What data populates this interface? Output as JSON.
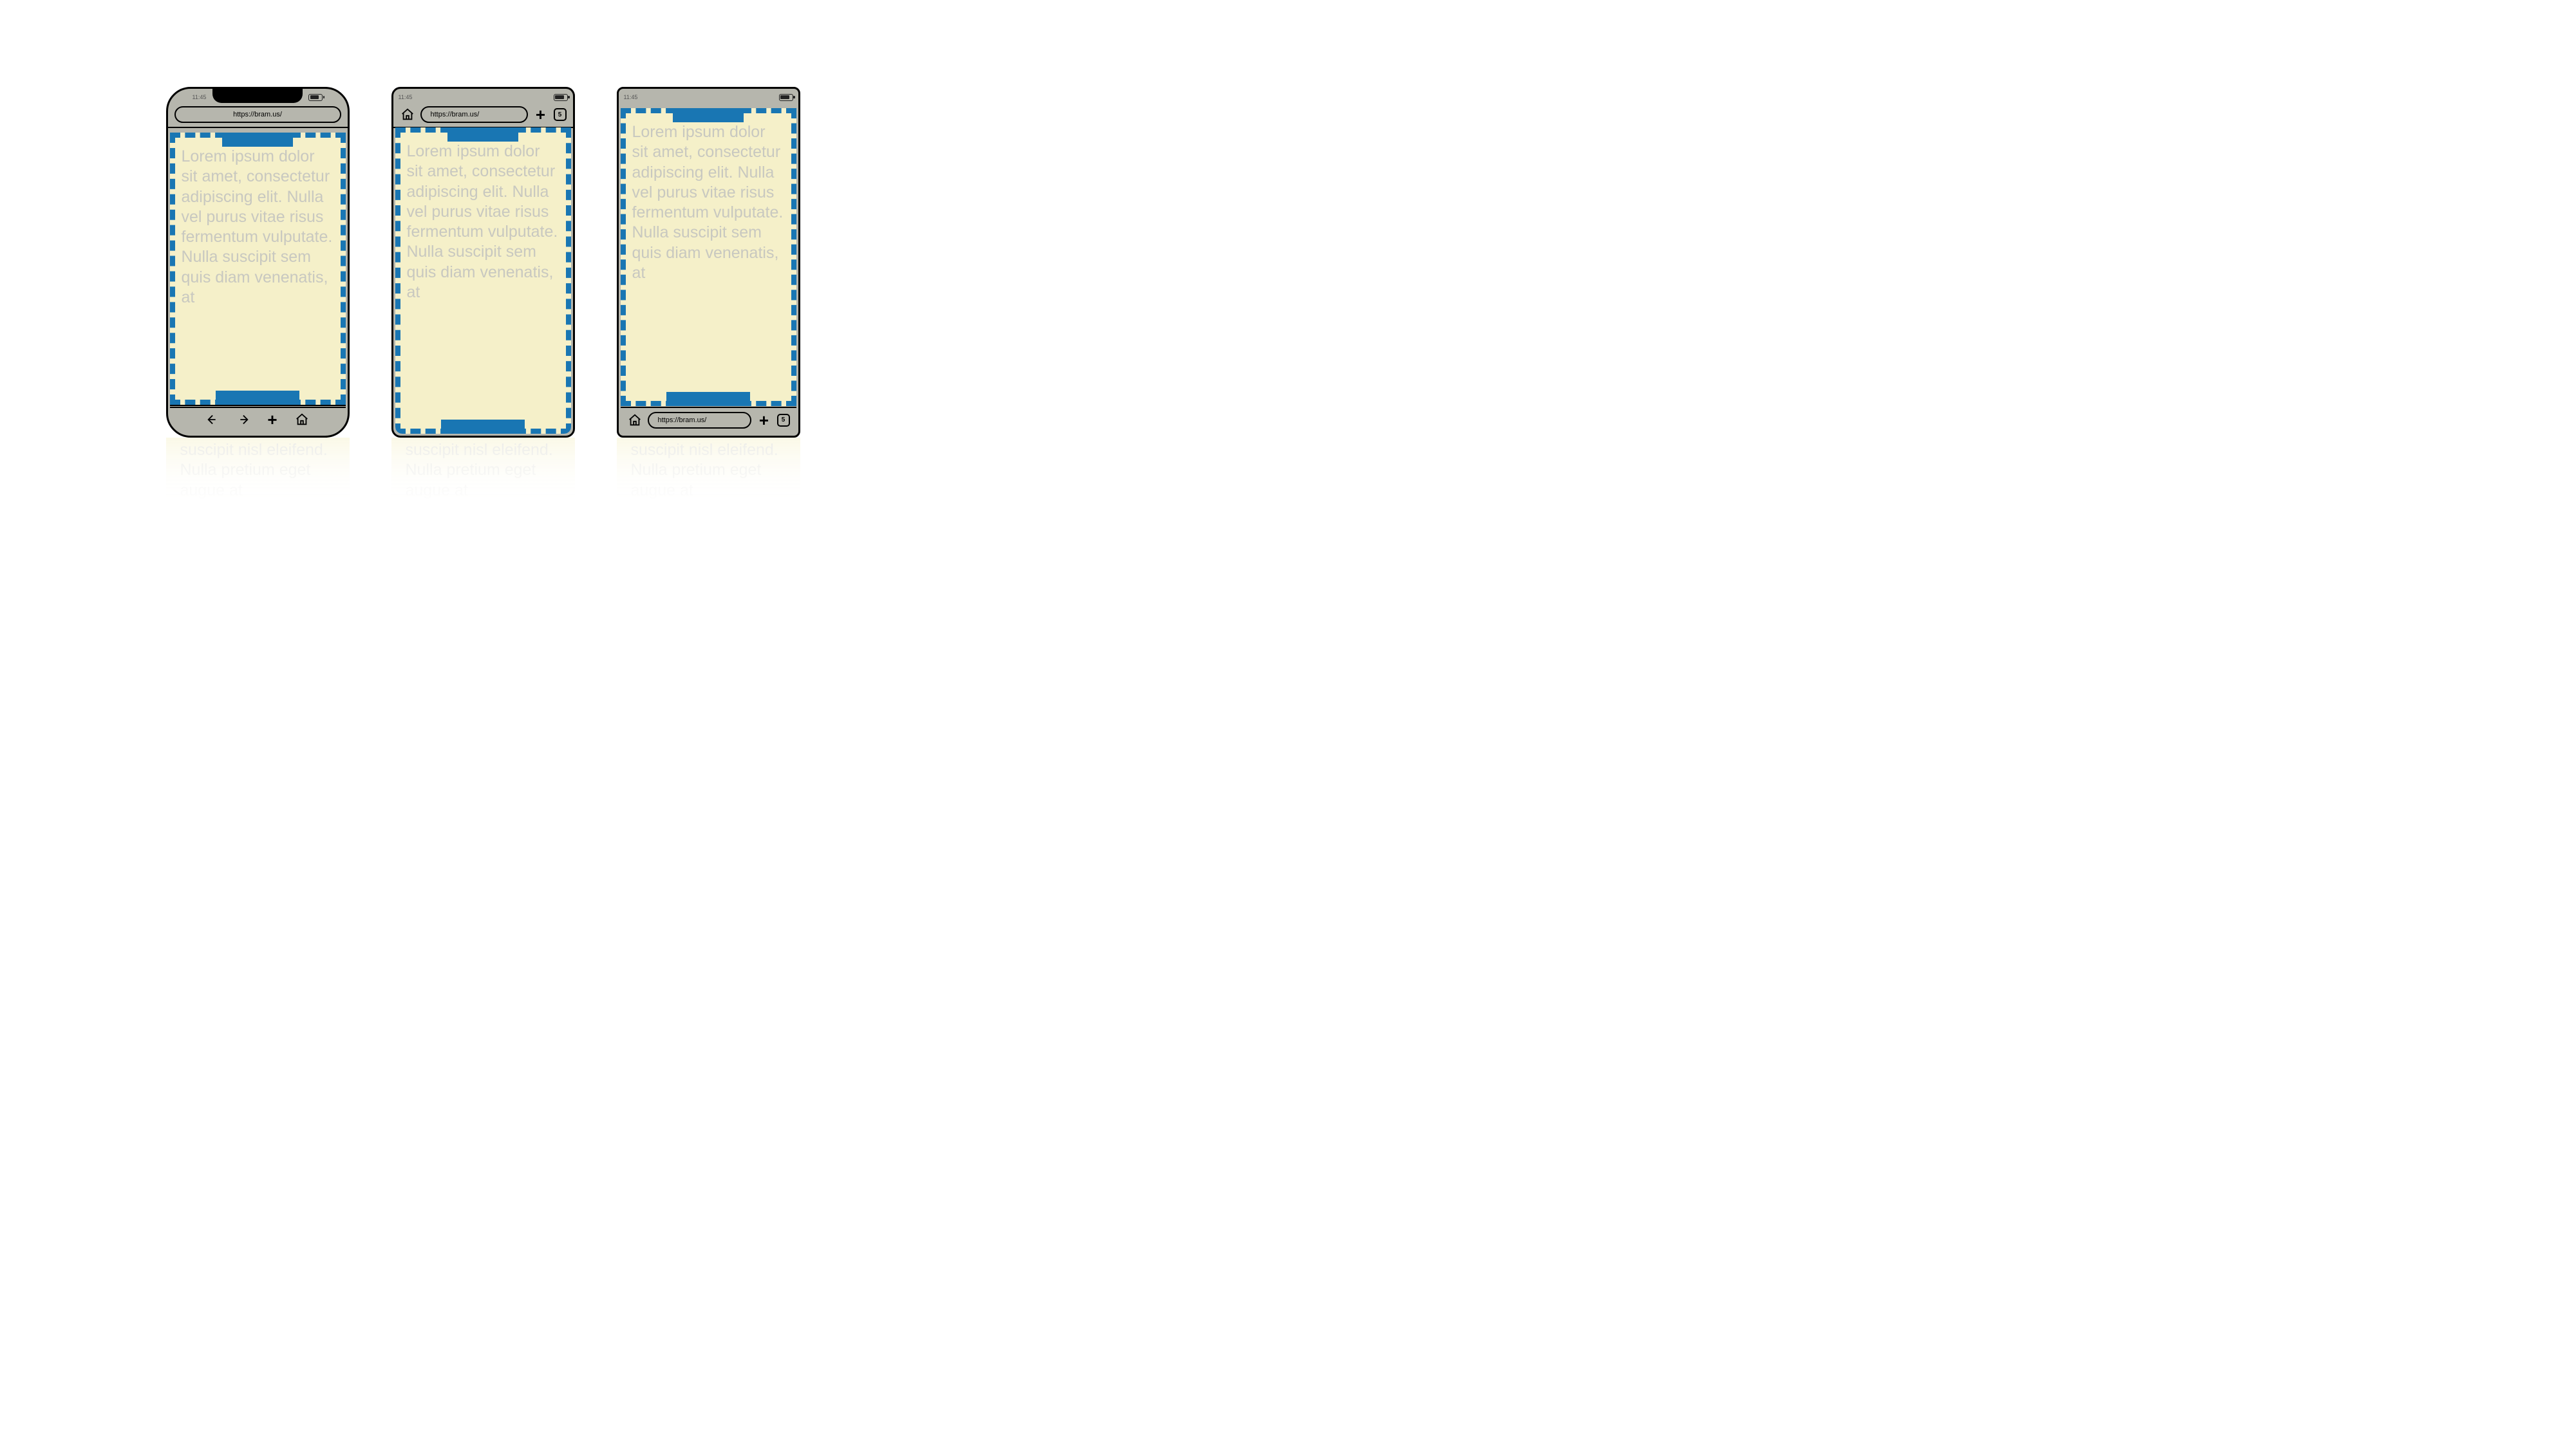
{
  "status": {
    "time": "11:45"
  },
  "url": "https://bram.us/",
  "tabs_count": "5",
  "lorem_visible": "Lorem ipsum dolor sit amet, consectetur adipiscing elit. Nulla vel purus vitae risus fermentum vulputate. Nulla suscipit sem quis diam venenatis, at",
  "lorem_overflow": "suscipit nisl eleifend. Nulla pretium eget augue at"
}
